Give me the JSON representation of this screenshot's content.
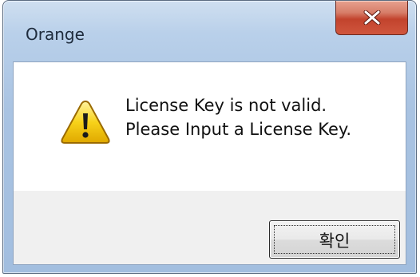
{
  "window": {
    "title": "Orange",
    "close_icon": "close-icon"
  },
  "dialog": {
    "icon": "warning-icon",
    "message_line1": "License Key is not valid.",
    "message_line2": "Please Input a License Key.",
    "ok_label": "확인"
  },
  "colors": {
    "frame": "#a9c3e2",
    "close_button": "#c2432d",
    "button_area": "#f0f0f0",
    "warning_yellow": "#f5c400"
  }
}
